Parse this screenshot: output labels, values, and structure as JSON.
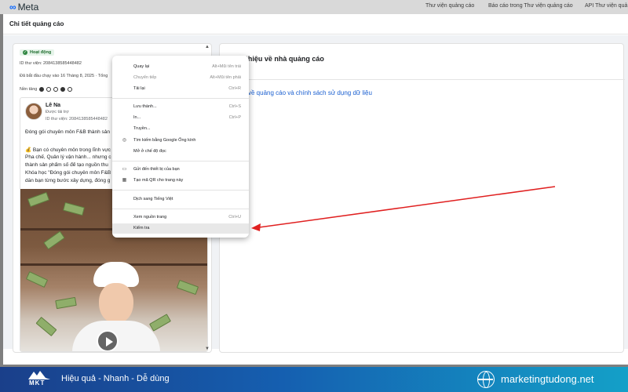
{
  "topbar": {
    "logo_text": "Meta",
    "nav": [
      "Thư viện quảng cáo",
      "Báo cáo trong Thư viện quảng cáo",
      "API Thư viện quả"
    ]
  },
  "modal": {
    "title": "Chi tiết quảng cáo"
  },
  "ad": {
    "status": "Hoạt động",
    "library_id": "ID thư viện: 2084138585448482",
    "started": "Đã bắt đầu chạy vào 16 Tháng 8, 2025 · Tổng",
    "platforms_label": "Nền tảng",
    "advertiser": "Lê Na",
    "sponsored": "Được tài trợ",
    "card_library_id": "ID thư viện: 2084138585448482",
    "text_lines": [
      "Đóng gói chuyên môn F&B thành sản",
      "💰 Bạn có chuyên môn trong lĩnh vực",
      "Pha chế, Quản lý vận hành... nhưng c",
      "thành sản phẩm số để tạo nguồn thu",
      "Khóa học \"Đóng gói chuyên môn F&B",
      "dẫn bạn từng bước xây dựng, đóng g"
    ]
  },
  "right": {
    "title": "Giới thiệu về nhà quảng cáo",
    "link": "về quảng cáo và chính sách sử dụng dữ liệu"
  },
  "context_menu": {
    "items": [
      {
        "label": "Quay lại",
        "shortcut": "Alt+Mũi tên trái",
        "disabled": false,
        "icon": ""
      },
      {
        "label": "Chuyển tiếp",
        "shortcut": "Alt+Mũi tên phải",
        "disabled": true,
        "icon": ""
      },
      {
        "label": "Tải lại",
        "shortcut": "Ctrl+R",
        "disabled": false,
        "icon": ""
      },
      {
        "label": "Lưu thành...",
        "shortcut": "Ctrl+S",
        "disabled": false,
        "icon": ""
      },
      {
        "label": "In...",
        "shortcut": "Ctrl+P",
        "disabled": false,
        "icon": ""
      },
      {
        "label": "Truyền...",
        "shortcut": "",
        "disabled": false,
        "icon": ""
      },
      {
        "label": "Tìm kiếm bằng Google Ống kính",
        "shortcut": "",
        "disabled": false,
        "icon": "lens-icon"
      },
      {
        "label": "Mở ở chế độ đọc",
        "shortcut": "",
        "disabled": false,
        "icon": ""
      },
      {
        "label": "Gửi đến thiết bị của bạn",
        "shortcut": "",
        "disabled": false,
        "icon": "device-icon"
      },
      {
        "label": "Tạo mã QR cho trang này",
        "shortcut": "",
        "disabled": false,
        "icon": "qr-icon"
      },
      {
        "label": "Dịch sang Tiếng Việt",
        "shortcut": "",
        "disabled": false,
        "icon": ""
      },
      {
        "label": "Xem nguồn trang",
        "shortcut": "Ctrl+U",
        "disabled": false,
        "icon": ""
      },
      {
        "label": "Kiểm tra",
        "shortcut": "",
        "disabled": false,
        "icon": ""
      }
    ]
  },
  "footer": {
    "brand": "MKT",
    "tagline": "Hiệu quả - Nhanh - Dễ dùng",
    "website": "marketingtudong.net"
  },
  "colors": {
    "annotation_arrow": "#e02020",
    "link": "#1a5fd0",
    "status_green": "#2e8540",
    "footer_start": "#1a3f8a",
    "footer_end": "#14a0c8"
  }
}
